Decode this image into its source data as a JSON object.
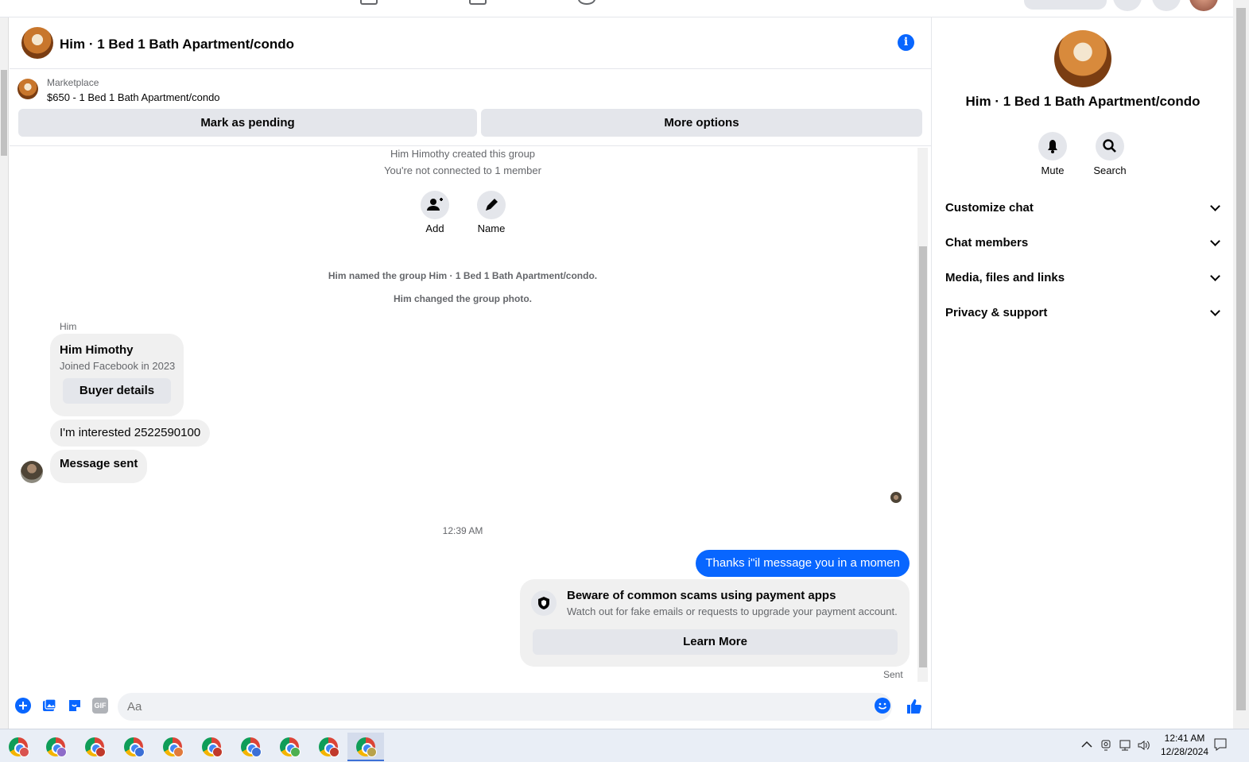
{
  "header": {
    "title": "Him · 1 Bed 1 Bath Apartment/condo",
    "info_glyph": "i"
  },
  "marketplace": {
    "label": "Marketplace",
    "item": "$650 - 1 Bed 1 Bath Apartment/condo",
    "mark_pending_label": "Mark as pending",
    "more_options_label": "More options"
  },
  "thread": {
    "created": "Him Himothy created this group",
    "not_connected": "You're not connected to 1 member",
    "add_label": "Add",
    "name_label": "Name",
    "named_event": "Him named the group Him · 1 Bed 1 Bath Apartment/condo.",
    "photo_event": "Him changed the group photo.",
    "sender_name": "Him",
    "buyer_card": {
      "name": "Him Himothy",
      "joined": "Joined Facebook in 2023",
      "button": "Buyer details"
    },
    "msg_interested": "I'm interested 2522590100",
    "msg_sent": "Message sent",
    "timestamp": "12:39 AM",
    "outgoing": "Thanks i\"il message you in a momen",
    "scam_notice": {
      "title": "Beware of common scams using payment apps",
      "body": "Watch out for fake emails or requests to upgrade your payment account.",
      "button": "Learn More"
    },
    "status": "Sent"
  },
  "composer": {
    "placeholder": "Aa",
    "icons": [
      "plus-icon",
      "photo-icon",
      "sticker-icon",
      "gif-icon",
      "emoji-icon",
      "thumbs-up-icon"
    ],
    "gif_text": "GIF"
  },
  "right_panel": {
    "title": "Him · 1 Bed 1 Bath Apartment/condo",
    "mute_label": "Mute",
    "search_label": "Search",
    "sections": [
      {
        "label": "Customize chat"
      },
      {
        "label": "Chat members"
      },
      {
        "label": "Media, files and links"
      },
      {
        "label": "Privacy & support"
      }
    ]
  },
  "taskbar": {
    "time": "12:41 AM",
    "date": "12/28/2024",
    "badge_colors": [
      "#d9534f",
      "#8e6cc9",
      "#c0392b",
      "#3b6fd6",
      "#e07a3c",
      "#c0392b",
      "#3b6fd6",
      "#4caf50",
      "#c0392b",
      "#b9a24a"
    ]
  },
  "colors": {
    "accent": "#0866ff",
    "bubble_gray": "#f0f0f0",
    "button_gray": "#e4e6eb"
  }
}
